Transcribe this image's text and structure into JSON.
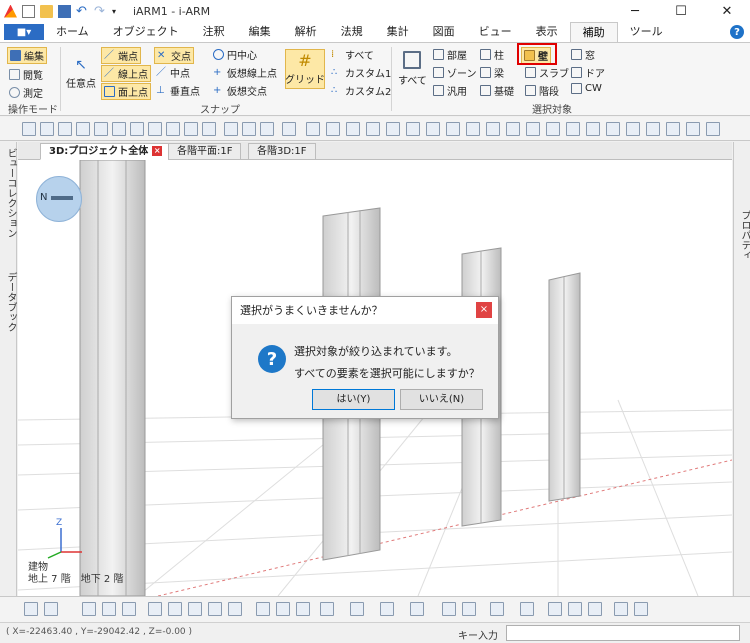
{
  "window": {
    "title": "iARM1 - i-ARM",
    "minimize": "─",
    "maximize": "☐",
    "close": "✕"
  },
  "menu": {
    "file_label": "■▾",
    "tabs": [
      "ホーム",
      "オブジェクト",
      "注釈",
      "編集",
      "解析",
      "法規",
      "集計",
      "図面",
      "ビュー",
      "表示",
      "補助",
      "ツール"
    ],
    "active_tab": "補助",
    "help": "?"
  },
  "ribbon": {
    "op_mode": {
      "edit": "編集",
      "browse": "閲覧",
      "measure": "測定",
      "group": "操作モード"
    },
    "snap": {
      "arbitrary": "任意点",
      "endpoint": "端点",
      "on_line": "線上点",
      "on_face": "面上点",
      "intersection": "交点",
      "midpoint": "中点",
      "perpendicular": "垂直点",
      "circle_center": "円中心",
      "virtual_on_line": "仮想線上点",
      "virtual_intersection": "仮想交点",
      "grid": "グリッド",
      "all": "すべて",
      "custom1": "カスタム1",
      "custom2": "カスタム2",
      "group": "スナップ"
    },
    "select_target": {
      "all": "すべて",
      "room": "部屋",
      "zone": "ゾーン",
      "general": "汎用",
      "column": "柱",
      "beam": "梁",
      "foundation": "基礎",
      "wall": "壁",
      "slab": "スラブ",
      "stair": "階段",
      "window": "窓",
      "door": "ドア",
      "cw": "CW",
      "group": "選択対象"
    }
  },
  "doc_tabs": [
    "3D:プロジェクト全体",
    "各階平面:1F",
    "各階3D:1F"
  ],
  "left_panel": {
    "view_collection": "ビューコレクション",
    "data_book": "データブック"
  },
  "right_panel": {
    "property": "プロパティ"
  },
  "viewport": {
    "compass_label": "N",
    "building_label": "建物",
    "floors_label": "地上 7 階　地下 2 階",
    "axis_z": "Z"
  },
  "dialog": {
    "title": "選択がうまくいきませんか？",
    "close": "×",
    "icon": "?",
    "line1": "選択対象が絞り込まれています。",
    "line2": "すべての要素を選択可能にしますか？",
    "yes": "はい(Y)",
    "no": "いいえ(N)"
  },
  "status": {
    "coords": "( X=-22463.40 , Y=-29042.42 , Z=-0.00 )",
    "key_input": "キー入力"
  },
  "colors": {
    "accent": "#2b6cc4",
    "highlight": "#fde8a6",
    "red_box": "#e00000",
    "dialog_icon": "#1e78c8"
  }
}
